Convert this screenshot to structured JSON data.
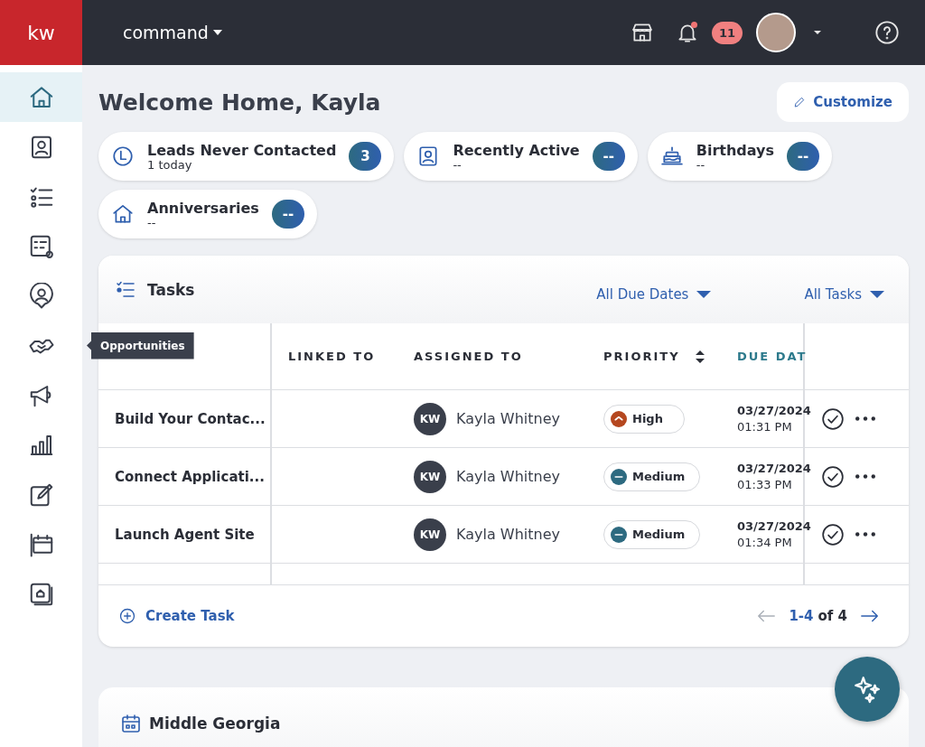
{
  "topbar": {
    "logo": "kw",
    "product": "command",
    "notifications": "11",
    "unread": true
  },
  "sidebar": {
    "items": [
      {
        "kind": "home",
        "selected": true
      },
      {
        "kind": "contact",
        "selected": false
      },
      {
        "kind": "tasks",
        "selected": false
      },
      {
        "kind": "checklist-gear",
        "selected": false
      },
      {
        "kind": "person-pin",
        "selected": false
      },
      {
        "kind": "handshake",
        "selected": false,
        "tooltip": "Opportunities"
      },
      {
        "kind": "megaphone",
        "selected": false
      },
      {
        "kind": "chart",
        "selected": false
      },
      {
        "kind": "edit",
        "selected": false
      },
      {
        "kind": "calendar",
        "selected": false
      },
      {
        "kind": "gallery",
        "selected": false
      }
    ]
  },
  "page": {
    "title": "Welcome Home, Kayla",
    "customize": "Customize"
  },
  "highlights": [
    {
      "kind": "clock",
      "title": "Leads Never Contacted",
      "subtitle": "1 today",
      "count": "3"
    },
    {
      "kind": "contact",
      "title": "Recently Active",
      "subtitle": "--",
      "count": "--"
    },
    {
      "kind": "cake",
      "title": "Birthdays",
      "subtitle": "--",
      "count": "--"
    },
    {
      "kind": "home",
      "title": "Anniversaries",
      "subtitle": "--",
      "count": "--"
    }
  ],
  "tasks": {
    "title": "Tasks",
    "filters": [
      "All Due Dates",
      "All Tasks"
    ],
    "columns": [
      {
        "label": "LINKED TO",
        "sortable": false,
        "active": false
      },
      {
        "label": "ASSIGNED TO",
        "sortable": false,
        "active": false
      },
      {
        "label": "PRIORITY",
        "sortable": true,
        "active": false
      },
      {
        "label": "DUE DAT",
        "sortable": false,
        "active": true
      }
    ],
    "rows": [
      {
        "task": "Build Your Contac...",
        "initials": "KW",
        "assignee": "Kayla Whitney",
        "priority": {
          "label": "High",
          "kind": "high"
        },
        "due_date": "03/27/2024",
        "due_time": "01:31 PM"
      },
      {
        "task": "Connect Applicati...",
        "initials": "KW",
        "assignee": "Kayla Whitney",
        "priority": {
          "label": "Medium",
          "kind": "medium"
        },
        "due_date": "03/27/2024",
        "due_time": "01:33 PM"
      },
      {
        "task": "Launch Agent Site",
        "initials": "KW",
        "assignee": "Kayla Whitney",
        "priority": {
          "label": "Medium",
          "kind": "medium"
        },
        "due_date": "03/27/2024",
        "due_time": "01:34 PM"
      }
    ],
    "create": "Create Task",
    "pagination": {
      "range": "1-4",
      "total": "of 4",
      "prev_disabled": true
    }
  },
  "region": {
    "title": "Middle Georgia"
  }
}
